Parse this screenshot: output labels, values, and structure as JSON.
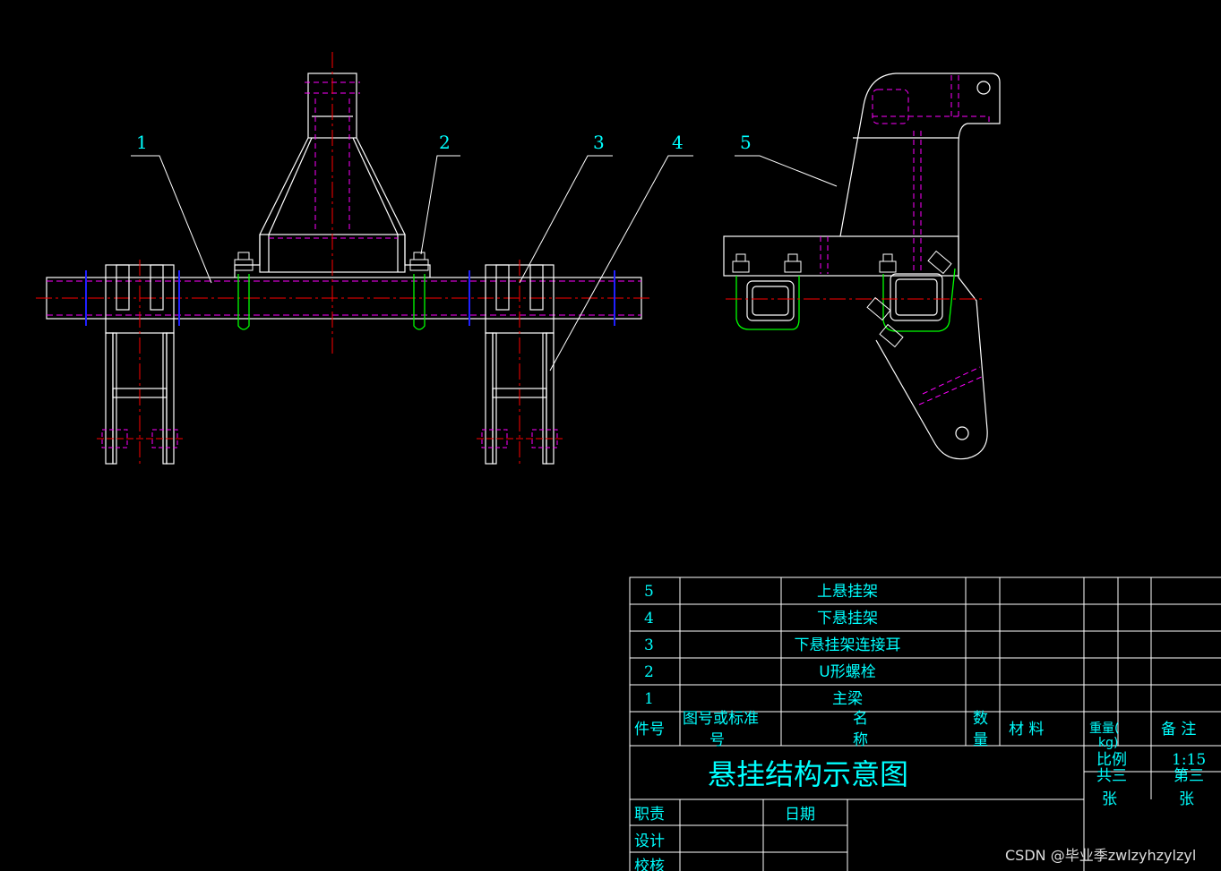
{
  "callouts": [
    "1",
    "2",
    "3",
    "4",
    "5"
  ],
  "parts_list": [
    {
      "no": "5",
      "name": "上悬挂架"
    },
    {
      "no": "4",
      "name": "下悬挂架"
    },
    {
      "no": "3",
      "name": "下悬挂架连接耳"
    },
    {
      "no": "2",
      "name": "U形螺栓"
    },
    {
      "no": "1",
      "name": "主梁"
    }
  ],
  "header": {
    "item_no": "件号",
    "drawing_no_1": "图号或标准",
    "drawing_no_2": "号",
    "name_1": "名",
    "name_2": "称",
    "qty_1": "数",
    "qty_2": "量",
    "material": "材 料",
    "weight_1": "重量(",
    "weight_2": "kg)",
    "remarks": "备 注"
  },
  "title_block": {
    "title": "悬挂结构示意图",
    "scale_label": "比例",
    "scale_value": "1:15",
    "sheets_total": "共三",
    "sheets_total_unit": "张",
    "sheet_no": "第三",
    "sheet_no_unit": "张",
    "role": "职责",
    "date": "日期",
    "design": "设计",
    "check": "校核"
  },
  "watermark": "CSDN @毕业季zwlzyhzylzyl",
  "colors": {
    "background": "#000000",
    "outline": "#ffffff",
    "text": "#00ffff",
    "hidden_lines": "#ff00ff",
    "center_lines": "#ff0000",
    "u_bolts": "#00ff00",
    "section_marks": "#0000ff"
  }
}
